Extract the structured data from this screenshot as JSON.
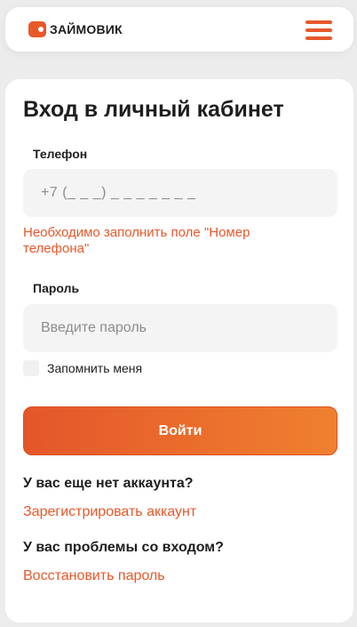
{
  "header": {
    "logo_text": "ЗАЙМОВИК"
  },
  "login": {
    "title": "Вход в личный кабинет",
    "phone_label": "Телефон",
    "phone_mask": "+7 (_ _ _) _ _ _  _ _  _ _",
    "phone_error": "Необходимо заполнить поле \"Номер телефона\"",
    "password_label": "Пароль",
    "password_placeholder": "Введите пароль",
    "remember_label": "Запомнить меня",
    "submit_label": "Войти",
    "no_account_question": "У вас еще нет аккаунта?",
    "register_link": "Зарегистрировать аккаунт",
    "problems_question": "У вас проблемы со входом?",
    "restore_link": "Восстановить пароль"
  },
  "colors": {
    "accent": "#e8582a",
    "button_gradient_end": "#f0802f",
    "field_bg": "#f4f4f5"
  }
}
